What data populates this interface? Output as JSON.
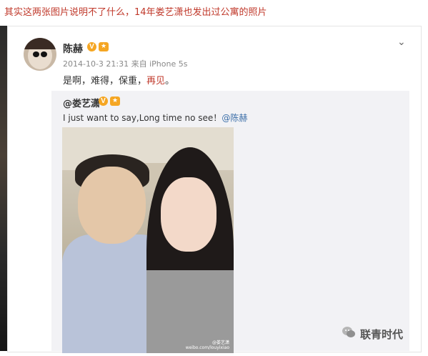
{
  "caption": "其实这两张图片说明不了什么，14年娄艺潇也发出过公寓的照片",
  "post": {
    "username": "陈赫",
    "meta": "2014-10-3 21:31 来自 iPhone 5s",
    "text_main": "是啊，难得，保重，",
    "text_red": "再见",
    "text_end": "。"
  },
  "repost": {
    "username": "@娄艺潇",
    "text": "I just want to say,Long time no see！",
    "mention": "@陈赫"
  },
  "photo": {
    "watermark_line1": "@娄艺潇",
    "watermark_line2": "weibo.com/louyixiao"
  },
  "logo": {
    "text": "联青时代"
  },
  "colors": {
    "caption": "#c0392b",
    "badge": "#f5a623",
    "link": "#3b6ea8"
  },
  "icons": [
    "verified-v-icon",
    "level-badge-icon",
    "chevron-down-icon",
    "wechat-logo-icon"
  ]
}
